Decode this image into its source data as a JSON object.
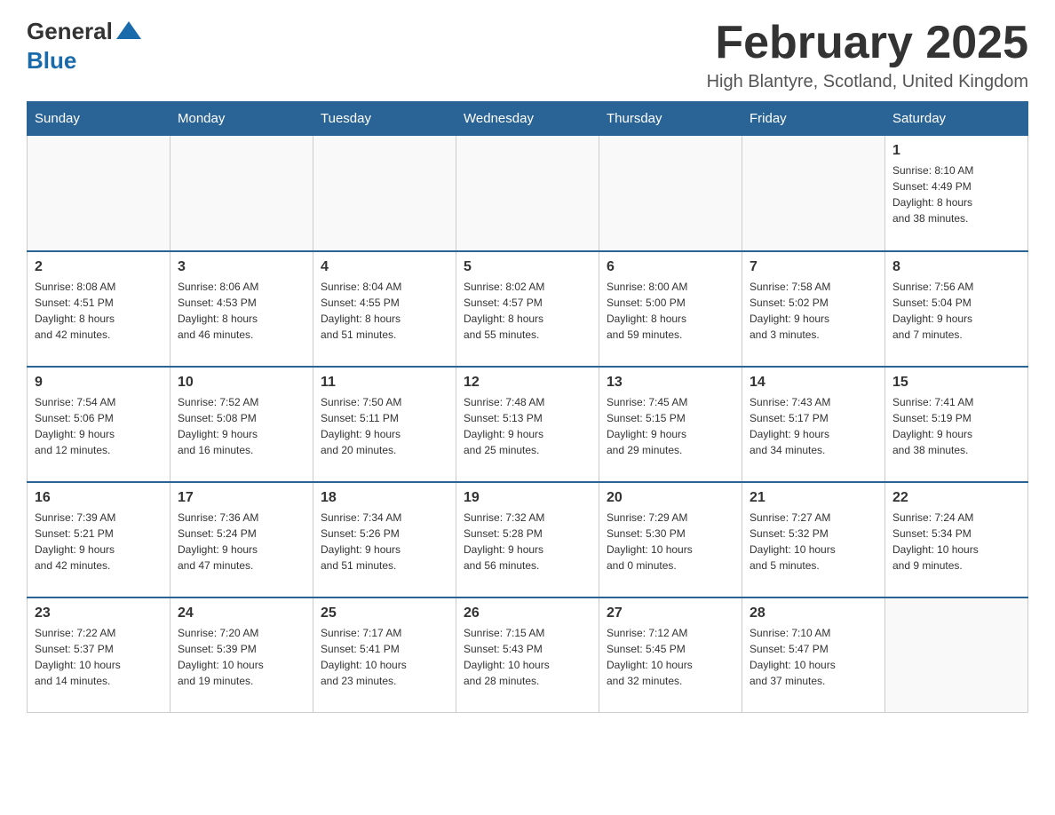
{
  "header": {
    "logo_general": "General",
    "logo_blue": "Blue",
    "month_title": "February 2025",
    "location": "High Blantyre, Scotland, United Kingdom"
  },
  "days_of_week": [
    "Sunday",
    "Monday",
    "Tuesday",
    "Wednesday",
    "Thursday",
    "Friday",
    "Saturday"
  ],
  "weeks": [
    [
      {
        "day": "",
        "info": ""
      },
      {
        "day": "",
        "info": ""
      },
      {
        "day": "",
        "info": ""
      },
      {
        "day": "",
        "info": ""
      },
      {
        "day": "",
        "info": ""
      },
      {
        "day": "",
        "info": ""
      },
      {
        "day": "1",
        "info": "Sunrise: 8:10 AM\nSunset: 4:49 PM\nDaylight: 8 hours\nand 38 minutes."
      }
    ],
    [
      {
        "day": "2",
        "info": "Sunrise: 8:08 AM\nSunset: 4:51 PM\nDaylight: 8 hours\nand 42 minutes."
      },
      {
        "day": "3",
        "info": "Sunrise: 8:06 AM\nSunset: 4:53 PM\nDaylight: 8 hours\nand 46 minutes."
      },
      {
        "day": "4",
        "info": "Sunrise: 8:04 AM\nSunset: 4:55 PM\nDaylight: 8 hours\nand 51 minutes."
      },
      {
        "day": "5",
        "info": "Sunrise: 8:02 AM\nSunset: 4:57 PM\nDaylight: 8 hours\nand 55 minutes."
      },
      {
        "day": "6",
        "info": "Sunrise: 8:00 AM\nSunset: 5:00 PM\nDaylight: 8 hours\nand 59 minutes."
      },
      {
        "day": "7",
        "info": "Sunrise: 7:58 AM\nSunset: 5:02 PM\nDaylight: 9 hours\nand 3 minutes."
      },
      {
        "day": "8",
        "info": "Sunrise: 7:56 AM\nSunset: 5:04 PM\nDaylight: 9 hours\nand 7 minutes."
      }
    ],
    [
      {
        "day": "9",
        "info": "Sunrise: 7:54 AM\nSunset: 5:06 PM\nDaylight: 9 hours\nand 12 minutes."
      },
      {
        "day": "10",
        "info": "Sunrise: 7:52 AM\nSunset: 5:08 PM\nDaylight: 9 hours\nand 16 minutes."
      },
      {
        "day": "11",
        "info": "Sunrise: 7:50 AM\nSunset: 5:11 PM\nDaylight: 9 hours\nand 20 minutes."
      },
      {
        "day": "12",
        "info": "Sunrise: 7:48 AM\nSunset: 5:13 PM\nDaylight: 9 hours\nand 25 minutes."
      },
      {
        "day": "13",
        "info": "Sunrise: 7:45 AM\nSunset: 5:15 PM\nDaylight: 9 hours\nand 29 minutes."
      },
      {
        "day": "14",
        "info": "Sunrise: 7:43 AM\nSunset: 5:17 PM\nDaylight: 9 hours\nand 34 minutes."
      },
      {
        "day": "15",
        "info": "Sunrise: 7:41 AM\nSunset: 5:19 PM\nDaylight: 9 hours\nand 38 minutes."
      }
    ],
    [
      {
        "day": "16",
        "info": "Sunrise: 7:39 AM\nSunset: 5:21 PM\nDaylight: 9 hours\nand 42 minutes."
      },
      {
        "day": "17",
        "info": "Sunrise: 7:36 AM\nSunset: 5:24 PM\nDaylight: 9 hours\nand 47 minutes."
      },
      {
        "day": "18",
        "info": "Sunrise: 7:34 AM\nSunset: 5:26 PM\nDaylight: 9 hours\nand 51 minutes."
      },
      {
        "day": "19",
        "info": "Sunrise: 7:32 AM\nSunset: 5:28 PM\nDaylight: 9 hours\nand 56 minutes."
      },
      {
        "day": "20",
        "info": "Sunrise: 7:29 AM\nSunset: 5:30 PM\nDaylight: 10 hours\nand 0 minutes."
      },
      {
        "day": "21",
        "info": "Sunrise: 7:27 AM\nSunset: 5:32 PM\nDaylight: 10 hours\nand 5 minutes."
      },
      {
        "day": "22",
        "info": "Sunrise: 7:24 AM\nSunset: 5:34 PM\nDaylight: 10 hours\nand 9 minutes."
      }
    ],
    [
      {
        "day": "23",
        "info": "Sunrise: 7:22 AM\nSunset: 5:37 PM\nDaylight: 10 hours\nand 14 minutes."
      },
      {
        "day": "24",
        "info": "Sunrise: 7:20 AM\nSunset: 5:39 PM\nDaylight: 10 hours\nand 19 minutes."
      },
      {
        "day": "25",
        "info": "Sunrise: 7:17 AM\nSunset: 5:41 PM\nDaylight: 10 hours\nand 23 minutes."
      },
      {
        "day": "26",
        "info": "Sunrise: 7:15 AM\nSunset: 5:43 PM\nDaylight: 10 hours\nand 28 minutes."
      },
      {
        "day": "27",
        "info": "Sunrise: 7:12 AM\nSunset: 5:45 PM\nDaylight: 10 hours\nand 32 minutes."
      },
      {
        "day": "28",
        "info": "Sunrise: 7:10 AM\nSunset: 5:47 PM\nDaylight: 10 hours\nand 37 minutes."
      },
      {
        "day": "",
        "info": ""
      }
    ]
  ]
}
